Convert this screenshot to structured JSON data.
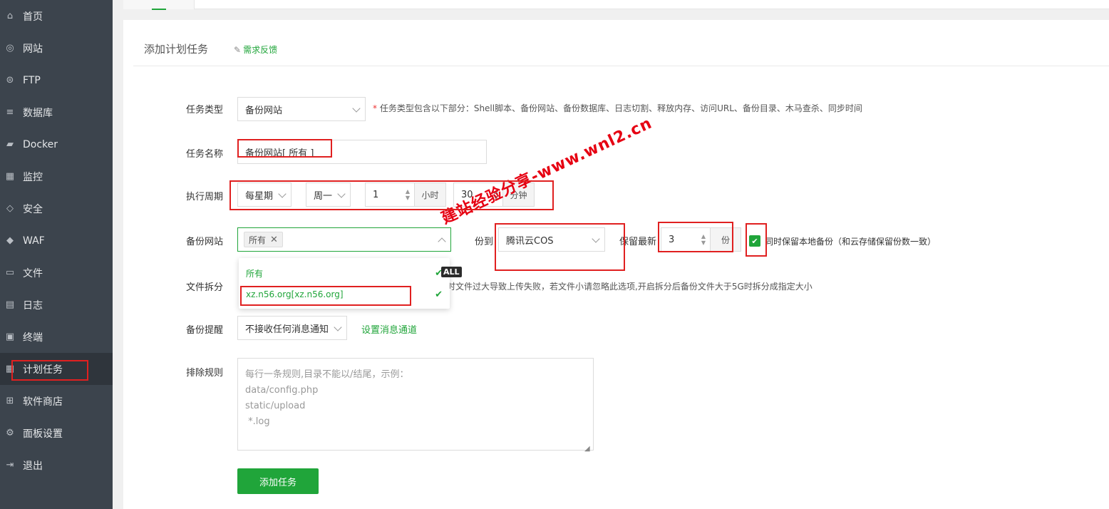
{
  "sidebar": {
    "items": [
      {
        "label": "首页",
        "icon": "home-icon"
      },
      {
        "label": "网站",
        "icon": "globe-icon"
      },
      {
        "label": "FTP",
        "icon": "ftp-icon"
      },
      {
        "label": "数据库",
        "icon": "database-icon"
      },
      {
        "label": "Docker",
        "icon": "docker-icon"
      },
      {
        "label": "监控",
        "icon": "monitor-icon"
      },
      {
        "label": "安全",
        "icon": "shield-icon"
      },
      {
        "label": "WAF",
        "icon": "waf-shield-icon"
      },
      {
        "label": "文件",
        "icon": "folder-icon"
      },
      {
        "label": "日志",
        "icon": "log-icon"
      },
      {
        "label": "终端",
        "icon": "terminal-icon"
      },
      {
        "label": "计划任务",
        "icon": "schedule-icon",
        "active": true
      },
      {
        "label": "软件商店",
        "icon": "apps-icon"
      },
      {
        "label": "面板设置",
        "icon": "gear-icon"
      },
      {
        "label": "退出",
        "icon": "logout-icon"
      }
    ]
  },
  "panel": {
    "title": "添加计划任务",
    "feedback_label": "需求反馈"
  },
  "form": {
    "task_type": {
      "label": "任务类型",
      "value": "备份网站",
      "hint_star": "*",
      "hint": "任务类型包含以下部分：Shell脚本、备份网站、备份数据库、日志切割、释放内存、访问URL、备份目录、木马查杀、同步时间"
    },
    "task_name": {
      "label": "任务名称",
      "value": "备份网站[ 所有 ]"
    },
    "period": {
      "label": "执行周期",
      "cycle": "每星期",
      "weekday": "周一",
      "hour": "1",
      "hour_unit": "小时",
      "minute": "30",
      "minute_unit": "分钟"
    },
    "backup_site": {
      "label": "备份网站",
      "selected_tag": "所有",
      "backup_to_label": "备份到",
      "backup_to_visible": "份到",
      "backup_to_value": "腾讯云COS",
      "keep_label": "保留最新",
      "keep_value": "3",
      "keep_unit": "份",
      "local_backup_label": "同时保留本地备份（和云存储保留份数一致）",
      "local_backup_visible": "同时保留本地备份（和云存储保留份数一致）",
      "local_backup_checked": true
    },
    "file_split": {
      "label": "文件拆分",
      "hint": "时文件过大导致上传失败，若文件小请忽略此选项,开启拆分后备份文件大于5G时拆分成指定大小"
    },
    "notify": {
      "label": "备份提醒",
      "value": "不接收任何消息通知",
      "link": "设置消息通道"
    },
    "exclude": {
      "label": "排除规则",
      "placeholder_lines": [
        "每行一条规则,目录不能以/结尾，示例：",
        "data/config.php",
        "static/upload",
        " *.log"
      ]
    },
    "submit_label": "添加任务"
  },
  "dropdown": {
    "options": [
      {
        "label": "所有",
        "selected": true
      },
      {
        "label": "xz.n56.org[xz.n56.org]",
        "selected": true
      }
    ],
    "badge": "ALL"
  },
  "watermark": "建站经验分享-www.wnl2.cn",
  "colors": {
    "accent": "#20a53a",
    "sidebar_bg": "#3c444d",
    "highlight": "#e02020",
    "watermark": "#e60012"
  }
}
